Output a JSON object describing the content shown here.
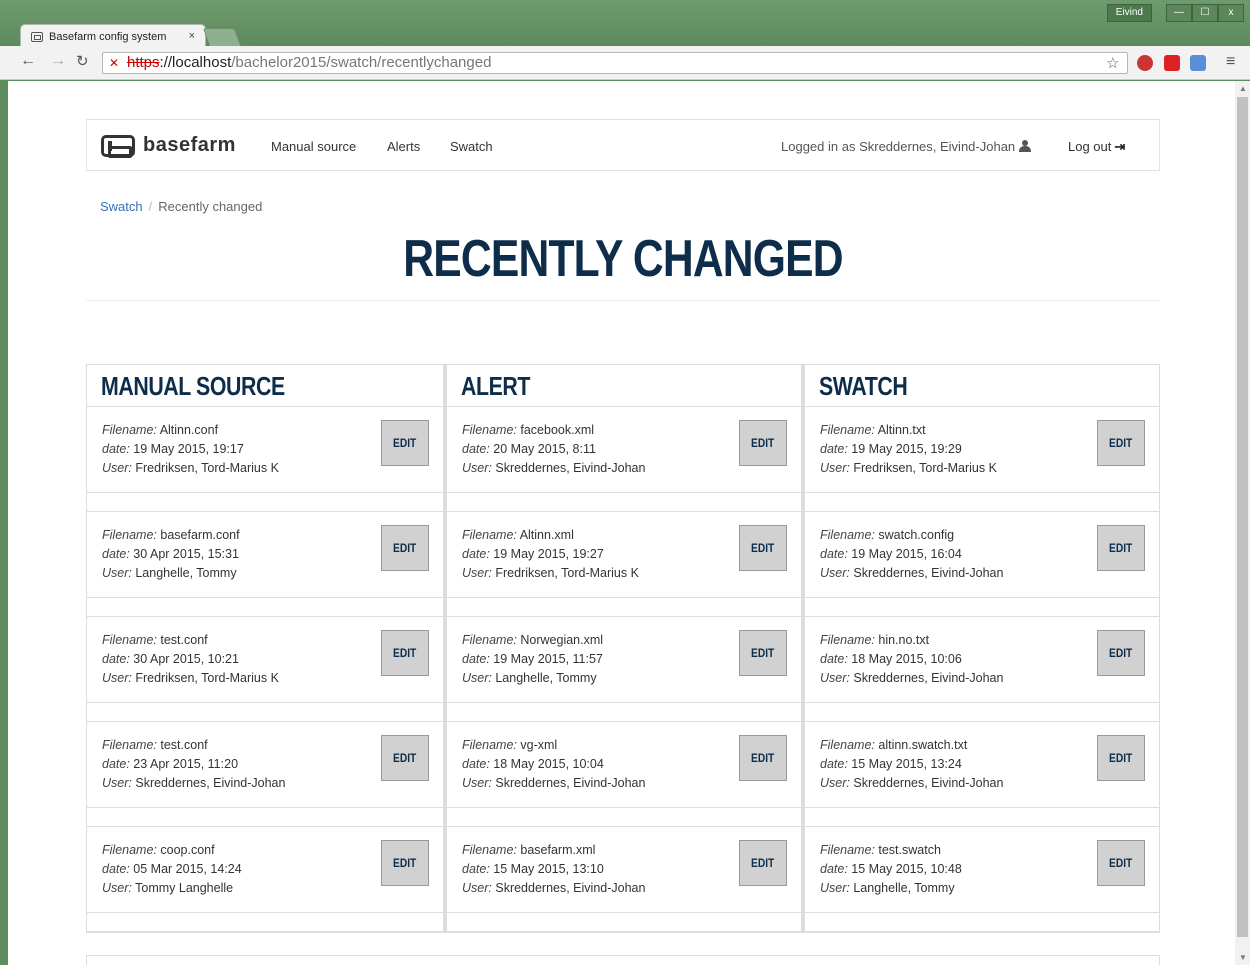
{
  "browser": {
    "tab_title": "Basefarm config system",
    "tab_close": "×",
    "window_user": "Eivind",
    "url_protocol": "https",
    "url_host": "://localhost",
    "url_path": "/bachelor2015/swatch/recentlychanged"
  },
  "navbar": {
    "brand": "basefarm",
    "links": [
      "Manual source",
      "Alerts",
      "Swatch"
    ],
    "logged_in": "Logged in as Skreddernes, Eivind-Johan",
    "logout": "Log out"
  },
  "breadcrumb": {
    "root": "Swatch",
    "current": "Recently changed"
  },
  "page_title": "RECENTLY CHANGED",
  "labels": {
    "filename": "Filename:",
    "date": "date:",
    "user": "User:",
    "edit": "EDIT"
  },
  "columns": [
    {
      "title": "MANUAL SOURCE",
      "items": [
        {
          "filename": "Altinn.conf",
          "date": "19 May 2015, 19:17",
          "user": "Fredriksen, Tord-Marius K"
        },
        {
          "filename": "basefarm.conf",
          "date": "30 Apr 2015, 15:31",
          "user": "Langhelle, Tommy"
        },
        {
          "filename": "test.conf",
          "date": "30 Apr 2015, 10:21",
          "user": "Fredriksen, Tord-Marius K"
        },
        {
          "filename": "test.conf",
          "date": "23 Apr 2015, 11:20",
          "user": "Skreddernes, Eivind-Johan"
        },
        {
          "filename": "coop.conf",
          "date": "05 Mar 2015, 14:24",
          "user": "Tommy Langhelle"
        }
      ]
    },
    {
      "title": "ALERT",
      "items": [
        {
          "filename": "facebook.xml",
          "date": "20 May 2015, 8:11",
          "user": "Skreddernes, Eivind-Johan"
        },
        {
          "filename": "Altinn.xml",
          "date": "19 May 2015, 19:27",
          "user": "Fredriksen, Tord-Marius K"
        },
        {
          "filename": "Norwegian.xml",
          "date": "19 May 2015, 11:57",
          "user": "Langhelle, Tommy"
        },
        {
          "filename": "vg-xml",
          "date": "18 May 2015, 10:04",
          "user": "Skreddernes, Eivind-Johan"
        },
        {
          "filename": "basefarm.xml",
          "date": "15 May 2015, 13:10",
          "user": "Skreddernes, Eivind-Johan"
        }
      ]
    },
    {
      "title": "SWATCH",
      "items": [
        {
          "filename": "Altinn.txt",
          "date": "19 May 2015, 19:29",
          "user": "Fredriksen, Tord-Marius K"
        },
        {
          "filename": "swatch.config",
          "date": "19 May 2015, 16:04",
          "user": "Skreddernes, Eivind-Johan"
        },
        {
          "filename": "hin.no.txt",
          "date": "18 May 2015, 10:06",
          "user": "Skreddernes, Eivind-Johan"
        },
        {
          "filename": "altinn.swatch.txt",
          "date": "15 May 2015, 13:24",
          "user": "Skreddernes, Eivind-Johan"
        },
        {
          "filename": "test.swatch",
          "date": "15 May 2015, 10:48",
          "user": "Langhelle, Tommy"
        }
      ]
    }
  ]
}
